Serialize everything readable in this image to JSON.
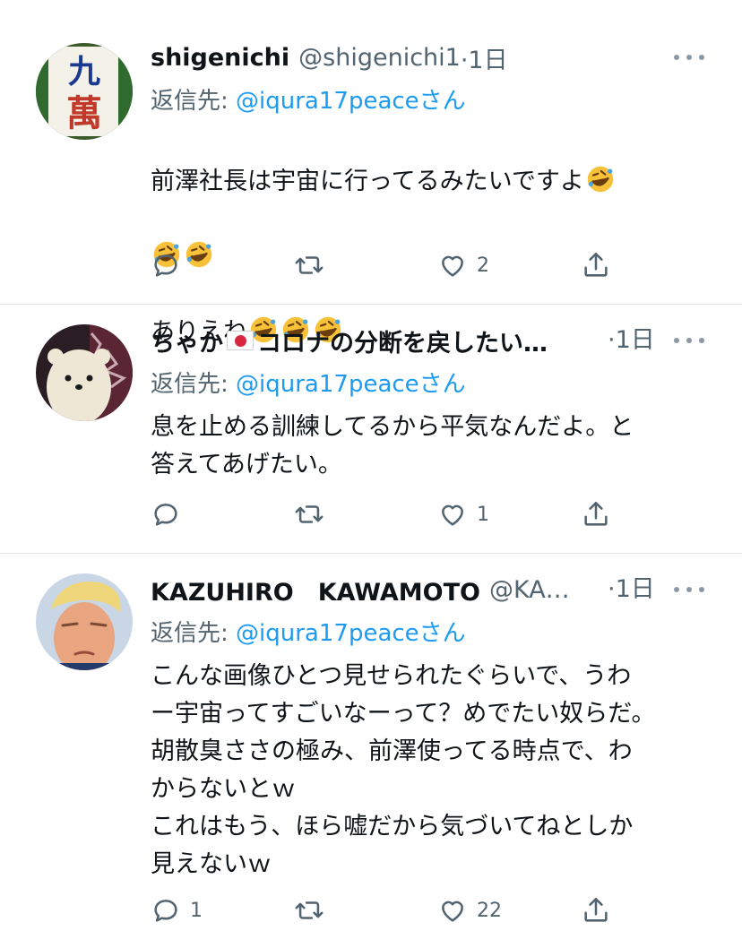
{
  "colors": {
    "link": "#1d9bf0",
    "secondary": "#536471",
    "divider": "#e1e6ea",
    "text": "#0f1419"
  },
  "tweets": [
    {
      "name": "shigenichi",
      "handle": "@shigenichi1",
      "time": "·1日",
      "reply_prefix": "返信先: ",
      "reply_to": "@iqura17peace",
      "reply_suffix": "さん",
      "avatar_text": "九萬",
      "body_line1": "前澤社長は宇宙に行ってるみたいですよ",
      "body_line3": "ありえね",
      "emoji": "rolling-on-floor-laughing-emoji",
      "reply_count": "",
      "retweet_count": "",
      "like_count": "2"
    },
    {
      "name": "ちゃか",
      "flag": "japan-flag-icon",
      "name_rest": "コロナの分断を戻したい…",
      "time": "·1日",
      "reply_prefix": "返信先: ",
      "reply_to": "@iqura17peace",
      "reply_suffix": "さん",
      "body": "息を止める訓練してるから平気なんだよ。と\n答えてあげたい。",
      "reply_count": "",
      "retweet_count": "",
      "like_count": "1"
    },
    {
      "name": "KAZUHIRO　KAWAMOTO",
      "handle": "@KA…",
      "time": "·1日",
      "reply_prefix": "返信先: ",
      "reply_to": "@iqura17peace",
      "reply_suffix": "さん",
      "body": "こんな画像ひとつ見せられたぐらいで、うわ\nー宇宙ってすごいなーって？めでたい奴らだ。\n胡散臭ささの極み、前澤使ってる時点で、わ\nからないとｗ\nこれはもう、ほら嘘だから気づいてねとしか\n見えないｗ",
      "reply_count": "1",
      "retweet_count": "",
      "like_count": "22"
    }
  ]
}
